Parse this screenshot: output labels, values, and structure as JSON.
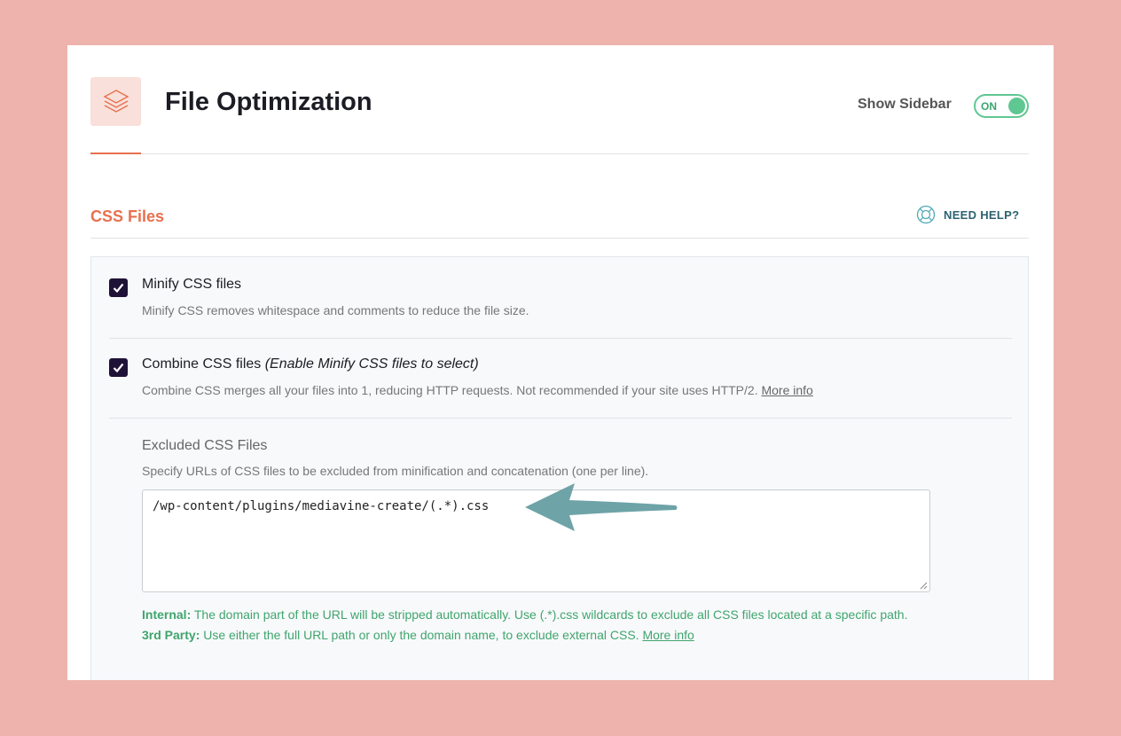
{
  "header": {
    "title": "File Optimization",
    "icon": "layers-icon",
    "show_sidebar_label": "Show Sidebar",
    "toggle_state": "ON"
  },
  "section": {
    "title": "CSS Files",
    "help_label": "NEED HELP?"
  },
  "options": [
    {
      "label": "Minify CSS files",
      "label_note": "",
      "checked": true,
      "description": "Minify CSS removes whitespace and comments to reduce the file size.",
      "link": ""
    },
    {
      "label": "Combine CSS files ",
      "label_note": "(Enable Minify CSS files to select)",
      "checked": true,
      "description": "Combine CSS merges all your files into 1, reducing HTTP requests. Not recommended if your site uses HTTP/2. ",
      "link": "More info"
    }
  ],
  "excluded": {
    "title": "Excluded CSS Files",
    "description": "Specify URLs of CSS files to be excluded from minification and concatenation (one per line).",
    "value": "/wp-content/plugins/mediavine-create/(.*).css",
    "internal_label": "Internal:",
    "internal_text": " The domain part of the URL will be stripped automatically. Use (.*).css wildcards to exclude all CSS files located at a specific path.",
    "third_label": "3rd Party:",
    "third_text": " Use either the full URL path or only the domain name, to exclude external CSS. ",
    "third_link": "More info"
  },
  "colors": {
    "accent": "#e8704e",
    "toggle": "#5fc792",
    "checkbox": "#1f1237",
    "note": "#3fa56d",
    "arrow": "#6ea3a8"
  }
}
